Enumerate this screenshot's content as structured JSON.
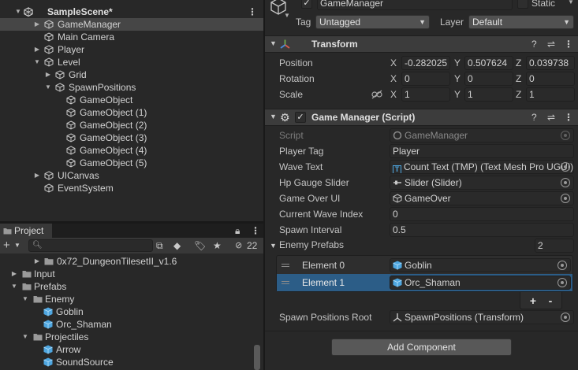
{
  "hierarchy": {
    "scene": "SampleScene*",
    "items": [
      {
        "label": "GameManager"
      },
      {
        "label": "Main Camera"
      },
      {
        "label": "Player"
      },
      {
        "label": "Level"
      },
      {
        "label": "Grid"
      },
      {
        "label": "SpawnPositions"
      },
      {
        "label": "GameObject"
      },
      {
        "label": "GameObject (1)"
      },
      {
        "label": "GameObject (2)"
      },
      {
        "label": "GameObject (3)"
      },
      {
        "label": "GameObject (4)"
      },
      {
        "label": "GameObject (5)"
      },
      {
        "label": "UICanvas"
      },
      {
        "label": "EventSystem"
      }
    ]
  },
  "project": {
    "tab": "Project",
    "hidden_count": "22",
    "items": [
      {
        "label": "0x72_DungeonTilesetII_v1.6"
      },
      {
        "label": "Input"
      },
      {
        "label": "Prefabs"
      },
      {
        "label": "Enemy"
      },
      {
        "label": "Goblin"
      },
      {
        "label": "Orc_Shaman"
      },
      {
        "label": "Projectiles"
      },
      {
        "label": "Arrow"
      },
      {
        "label": "SoundSource"
      }
    ]
  },
  "inspector": {
    "object_name": "GameManager",
    "static_label": "Static",
    "tag_label": "Tag",
    "tag_value": "Untagged",
    "layer_label": "Layer",
    "layer_value": "Default",
    "transform": {
      "title": "Transform",
      "position_label": "Position",
      "rotation_label": "Rotation",
      "scale_label": "Scale",
      "axes": {
        "x": "X",
        "y": "Y",
        "z": "Z"
      },
      "position": {
        "x": "-0.282025",
        "y": "0.507624",
        "z": "0.039738"
      },
      "rotation": {
        "x": "0",
        "y": "0",
        "z": "0"
      },
      "scale": {
        "x": "1",
        "y": "1",
        "z": "1"
      }
    },
    "script_component": {
      "title": "Game Manager (Script)",
      "script_label": "Script",
      "script_value": "GameManager",
      "player_tag_label": "Player Tag",
      "player_tag_value": "Player",
      "wave_text_label": "Wave Text",
      "wave_text_value": "Count Text (TMP) (Text Mesh Pro UGUI)",
      "hp_slider_label": "Hp Gauge Slider",
      "hp_slider_value": "Slider (Slider)",
      "game_over_label": "Game Over UI",
      "game_over_value": "GameOver",
      "current_wave_label": "Current Wave Index",
      "current_wave_value": "0",
      "spawn_interval_label": "Spawn Interval",
      "spawn_interval_value": "0.5",
      "enemy_prefabs_label": "Enemy Prefabs",
      "enemy_prefabs_count": "2",
      "elements": [
        {
          "label": "Element 0",
          "value": "Goblin"
        },
        {
          "label": "Element 1",
          "value": "Orc_Shaman"
        }
      ],
      "plus": "+",
      "minus": "-",
      "spawn_root_label": "Spawn Positions Root",
      "spawn_root_value": "SpawnPositions (Transform)"
    },
    "add_component": "Add Component"
  },
  "colors": {
    "panel": "#282828",
    "header": "#3c3c3c",
    "selection": "#2c5d87",
    "accent_icon": "#4ea6e0"
  }
}
